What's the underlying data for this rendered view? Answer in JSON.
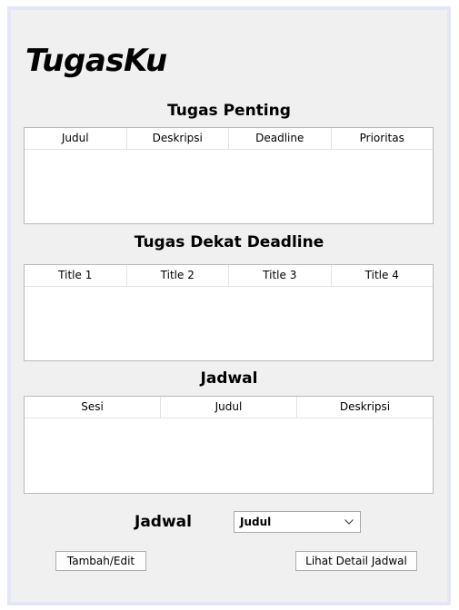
{
  "app": {
    "title": "TugasKu"
  },
  "sections": {
    "important": {
      "title": "Tugas Penting",
      "columns": [
        "Judul",
        "Deskripsi",
        "Deadline",
        "Prioritas"
      ]
    },
    "deadline": {
      "title": "Tugas Dekat Deadline",
      "columns": [
        "Title 1",
        "Title 2",
        "Title 3",
        "Title 4"
      ]
    },
    "schedule": {
      "title": "Jadwal",
      "columns": [
        "Sesi",
        "Judul",
        "Deskripsi"
      ]
    }
  },
  "footer": {
    "label": "Jadwal",
    "combo_value": "Judul",
    "combo_icon": "chevron-down-icon",
    "edit_button": "Tambah/Edit",
    "detail_button": "Lihat Detail Jadwal"
  },
  "colors": {
    "window_bg": "#f0f0f0",
    "window_border": "#e4e6f8",
    "table_bg": "#ffffff",
    "table_border": "#b9b9b9"
  }
}
